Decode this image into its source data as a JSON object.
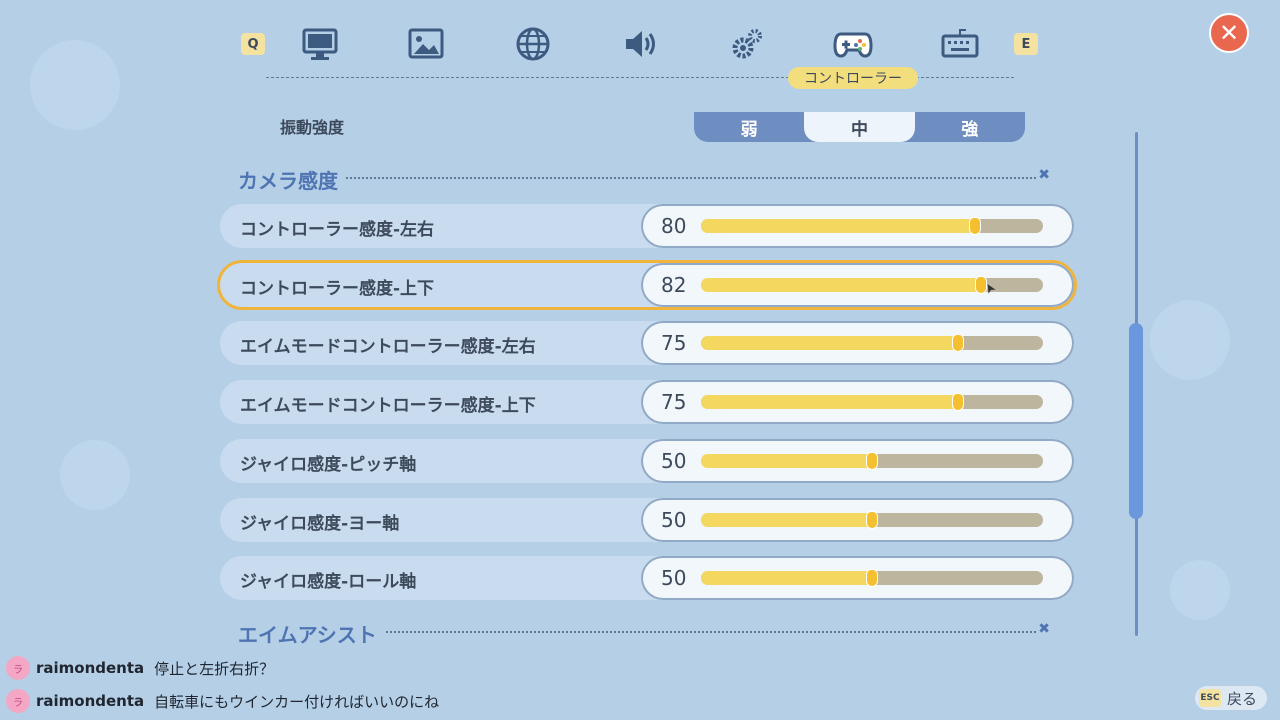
{
  "nav": {
    "prev_key": "Q",
    "next_key": "E",
    "tabs": [
      {
        "icon": "monitor-icon"
      },
      {
        "icon": "image-icon"
      },
      {
        "icon": "globe-icon"
      },
      {
        "icon": "speaker-icon"
      },
      {
        "icon": "gear-icon"
      },
      {
        "icon": "gamepad-icon",
        "active": true
      },
      {
        "icon": "keyboard-icon"
      }
    ],
    "active_label": "コントローラー"
  },
  "vibration": {
    "label": "振動強度",
    "options": [
      "弱",
      "中",
      "強"
    ],
    "selected": "中"
  },
  "sections": {
    "camera": "カメラ感度",
    "aim_assist": "エイムアシスト"
  },
  "settings": [
    {
      "label": "コントローラー感度-左右",
      "value": "80",
      "level": 0.8
    },
    {
      "label": "コントローラー感度-上下",
      "value": "82",
      "level": 0.82,
      "selected": true
    },
    {
      "label": "エイムモードコントローラー感度-左右",
      "value": "75",
      "level": 0.75
    },
    {
      "label": "エイムモードコントローラー感度-上下",
      "value": "75",
      "level": 0.75
    },
    {
      "label": "ジャイロ感度-ピッチ軸",
      "value": "50",
      "level": 0.5
    },
    {
      "label": "ジャイロ感度-ヨー軸",
      "value": "50",
      "level": 0.5
    },
    {
      "label": "ジャイロ感度-ロール軸",
      "value": "50",
      "level": 0.5
    }
  ],
  "scroll": {
    "position": 0.62
  },
  "chat": [
    {
      "user": "raimondenta",
      "message": "停止と左折右折？"
    },
    {
      "user": "raimondenta",
      "message": "自転車にもウインカー付ければいいのにね"
    }
  ],
  "footer": {
    "esc_key": "ESC",
    "back_label": "戻る"
  },
  "colors": {
    "accent": "#f4d75e",
    "selected_outline": "#f0b43c",
    "close": "#e8674e"
  }
}
